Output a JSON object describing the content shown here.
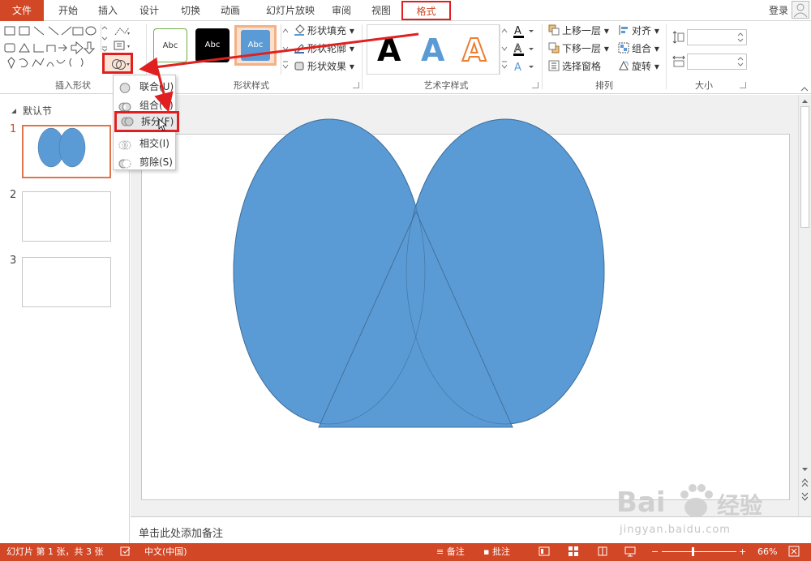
{
  "tabs": {
    "file": "文件",
    "items": [
      "开始",
      "插入",
      "设计",
      "切换",
      "动画",
      "幻灯片放映",
      "审阅",
      "视图"
    ],
    "format": "格式",
    "login": "登录"
  },
  "ribbon": {
    "groups": {
      "insert_shapes": "插入形状",
      "shape_styles": "形状样式",
      "wordart_styles": "艺术字样式",
      "arrange": "排列",
      "size": "大小"
    },
    "style_sample": "Abc",
    "shape_fill": "形状填充",
    "shape_outline": "形状轮廓",
    "shape_effects": "形状效果",
    "wordart_letter": "A",
    "bring_forward": "上移一层",
    "send_backward": "下移一层",
    "selection_pane": "选择窗格",
    "align": "对齐",
    "group": "组合",
    "rotate": "旋转"
  },
  "merge_menu": {
    "items": [
      {
        "label": "联合(U)",
        "name": "union"
      },
      {
        "label": "组合(C)",
        "name": "combine"
      },
      {
        "label": "拆分(F)",
        "name": "fragment"
      },
      {
        "label": "相交(I)",
        "name": "intersect"
      },
      {
        "label": "剪除(S)",
        "name": "subtract"
      }
    ]
  },
  "thumbnails": {
    "section": "默认节",
    "slides": [
      "1",
      "2",
      "3"
    ]
  },
  "notes": {
    "placeholder": "单击此处添加备注"
  },
  "status": {
    "slide_info": "幻灯片 第 1 张，共 3 张",
    "language": "中文(中国)",
    "notes": "备注",
    "comments": "批注",
    "zoom": "66%"
  },
  "colors": {
    "accent": "#d24726",
    "shape_fill": "#5b9bd5",
    "highlight": "#e02020"
  },
  "watermark": {
    "brand": "Bai",
    "brand2": "经验",
    "url": "jingyan.baidu.com"
  }
}
